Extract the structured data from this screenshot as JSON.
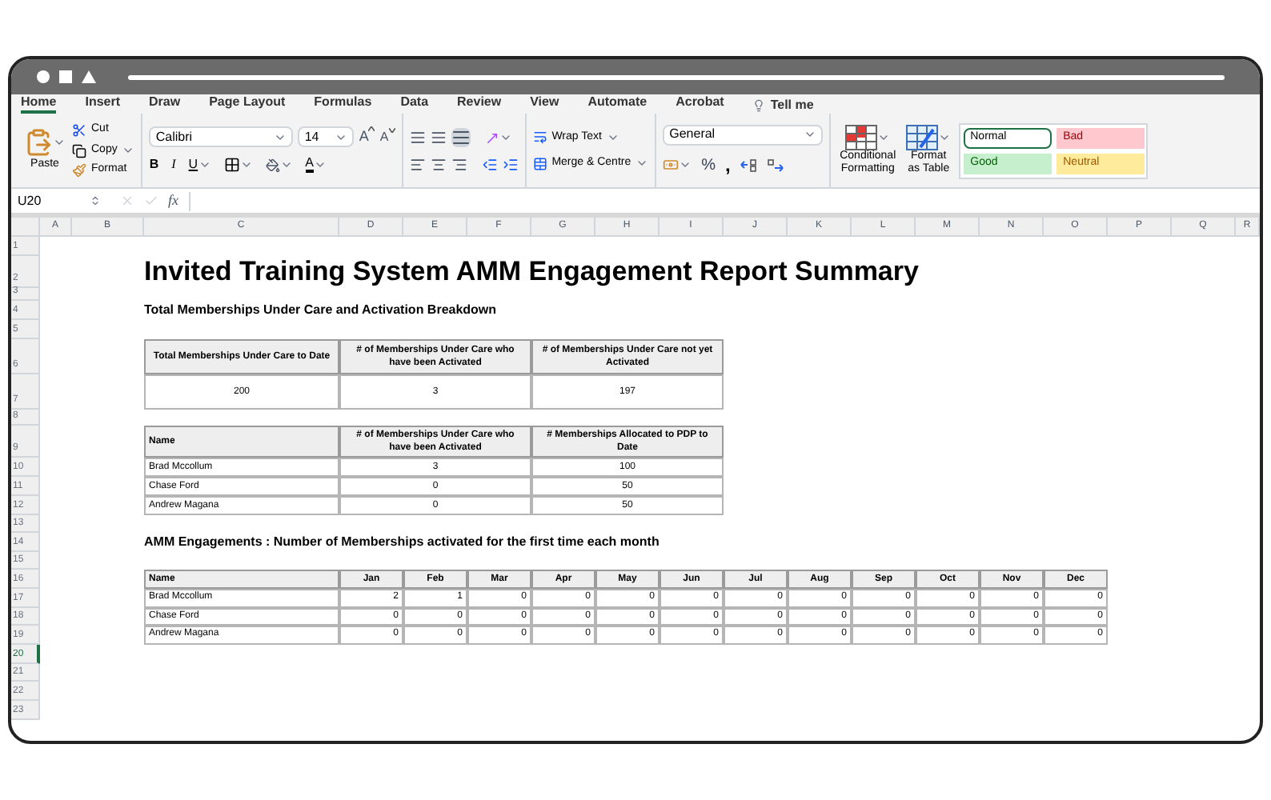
{
  "ribbon_tabs": [
    {
      "label": "Home",
      "selected": true
    },
    {
      "label": "Insert",
      "selected": false
    },
    {
      "label": "Draw",
      "selected": false
    },
    {
      "label": "Page Layout",
      "selected": false
    },
    {
      "label": "Formulas",
      "selected": false
    },
    {
      "label": "Data",
      "selected": false
    },
    {
      "label": "Review",
      "selected": false
    },
    {
      "label": "View",
      "selected": false
    },
    {
      "label": "Automate",
      "selected": false
    },
    {
      "label": "Acrobat",
      "selected": false
    }
  ],
  "tell_me": "Tell me",
  "clipboard": {
    "paste": "Paste",
    "cut": "Cut",
    "copy": "Copy",
    "format": "Format"
  },
  "font": {
    "name": "Calibri",
    "size": "14",
    "grow": "A",
    "shrink": "A",
    "bold": "B",
    "italic": "I",
    "underline": "U",
    "color_letter": "A"
  },
  "alignment": {
    "wrap": "Wrap Text",
    "merge": "Merge & Centre"
  },
  "number": {
    "format": "General",
    "percent": "%",
    "comma": ","
  },
  "cells": {
    "conditional": "Conditional Formatting",
    "format_table": "Format as Table"
  },
  "styles": [
    {
      "label": "Normal",
      "kind": "normal",
      "color": "#ffffff",
      "selected": true
    },
    {
      "label": "Bad",
      "kind": "bad",
      "color": "#ffc7ce",
      "selected": false
    },
    {
      "label": "Good",
      "kind": "good",
      "color": "#c6efce",
      "selected": false
    },
    {
      "label": "Neutral",
      "kind": "neutral",
      "color": "#ffeb9c",
      "selected": false
    }
  ],
  "formula_bar": {
    "name_box": "U20",
    "fx": "fx"
  },
  "columns": [
    "A",
    "B",
    "C",
    "D",
    "E",
    "F",
    "G",
    "H",
    "I",
    "J",
    "K",
    "L",
    "M",
    "N",
    "O",
    "P",
    "Q",
    "R"
  ],
  "rows": [
    {
      "label": "1",
      "selected": false
    },
    {
      "label": "2",
      "selected": false
    },
    {
      "label": "3",
      "selected": false
    },
    {
      "label": "4",
      "selected": false
    },
    {
      "label": "5",
      "selected": false
    },
    {
      "label": "6",
      "selected": false
    },
    {
      "label": "7",
      "selected": false
    },
    {
      "label": "8",
      "selected": false
    },
    {
      "label": "9",
      "selected": false
    },
    {
      "label": "10",
      "selected": false
    },
    {
      "label": "11",
      "selected": false
    },
    {
      "label": "12",
      "selected": false
    },
    {
      "label": "13",
      "selected": false
    },
    {
      "label": "14",
      "selected": false
    },
    {
      "label": "15",
      "selected": false
    },
    {
      "label": "16",
      "selected": false
    },
    {
      "label": "17",
      "selected": false
    },
    {
      "label": "18",
      "selected": false
    },
    {
      "label": "19",
      "selected": false
    },
    {
      "label": "20",
      "selected": true
    },
    {
      "label": "21",
      "selected": false
    },
    {
      "label": "22",
      "selected": false
    },
    {
      "label": "23",
      "selected": false
    }
  ],
  "sheet": {
    "title": "Invited Training System AMM Engagement Report Summary",
    "subtitle": "Total Memberships Under Care and Activation Breakdown",
    "summary_table": {
      "columns": [
        "Total Memberships Under Care to Date",
        "# of Memberships Under Care who have been Activated",
        "# of Memberships Under Care not yet Activated"
      ],
      "values": [
        "200",
        "3",
        "197"
      ]
    },
    "allocation_table": {
      "columns": [
        "Name",
        "# of Memberships Under Care who have been Activated",
        "# Memberships Allocated to PDP to Date"
      ],
      "rows": [
        [
          "Brad Mccollum",
          "3",
          "100"
        ],
        [
          "Chase Ford",
          "0",
          "50"
        ],
        [
          "Andrew Magana",
          "0",
          "50"
        ]
      ]
    },
    "engagements_title": "AMM Engagements : Number of Memberships activated for the first time each month",
    "engagements_table": {
      "columns": [
        "Name",
        "Jan",
        "Feb",
        "Mar",
        "Apr",
        "May",
        "Jun",
        "Jul",
        "Aug",
        "Sep",
        "Oct",
        "Nov",
        "Dec"
      ],
      "rows": [
        [
          "Brad Mccollum",
          "2",
          "1",
          "0",
          "0",
          "0",
          "0",
          "0",
          "0",
          "0",
          "0",
          "0",
          "0"
        ],
        [
          "Chase Ford",
          "0",
          "0",
          "0",
          "0",
          "0",
          "0",
          "0",
          "0",
          "0",
          "0",
          "0",
          "0"
        ],
        [
          "Andrew Magana",
          "0",
          "0",
          "0",
          "0",
          "0",
          "0",
          "0",
          "0",
          "0",
          "0",
          "0",
          "0"
        ]
      ]
    }
  }
}
